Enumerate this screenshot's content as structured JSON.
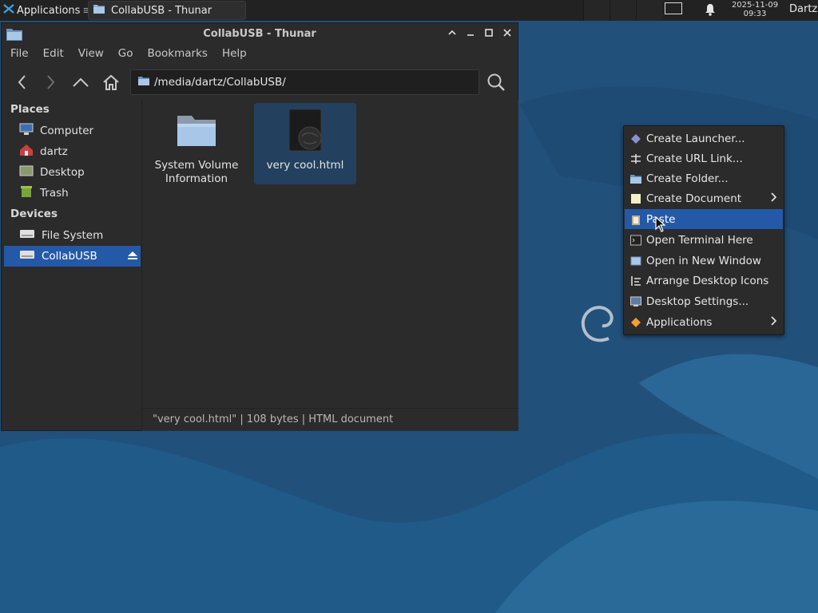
{
  "panel": {
    "applications_label": "Applications",
    "applications_suffix": "≡",
    "task_label": "CollabUSB - Thunar",
    "clock_date": "2025-11-09",
    "clock_time": "09:33",
    "user": "Dartz"
  },
  "window": {
    "title": "CollabUSB - Thunar",
    "menu": [
      "File",
      "Edit",
      "View",
      "Go",
      "Bookmarks",
      "Help"
    ],
    "path": "/media/dartz/CollabUSB/",
    "sidebar": {
      "places_header": "Places",
      "places": [
        {
          "label": "Computer",
          "icon": "computer-icon"
        },
        {
          "label": "dartz",
          "icon": "home-icon"
        },
        {
          "label": "Desktop",
          "icon": "desktop-icon"
        },
        {
          "label": "Trash",
          "icon": "trash-icon"
        }
      ],
      "devices_header": "Devices",
      "devices": [
        {
          "label": "File System",
          "icon": "drive-icon"
        },
        {
          "label": "CollabUSB",
          "icon": "usb-drive-icon",
          "selected": true
        }
      ]
    },
    "files": [
      {
        "name_line1": "System Volume",
        "name_line2": "Information",
        "icon": "folder-icon",
        "selected": false
      },
      {
        "name_line1": "very cool.html",
        "name_line2": "",
        "icon": "html-file-icon",
        "selected": true
      }
    ],
    "status": {
      "text": "\"very cool.html\"  |  108 bytes  |  HTML document"
    }
  },
  "context_menu": {
    "items": [
      {
        "label": "Create Launcher...",
        "icon": "launcher-icon",
        "submenu": false
      },
      {
        "label": "Create URL Link...",
        "icon": "link-icon",
        "submenu": false
      },
      {
        "label": "Create Folder...",
        "icon": "folder-icon",
        "submenu": false
      },
      {
        "label": "Create Document",
        "icon": "document-icon",
        "submenu": true
      },
      {
        "label": "Paste",
        "icon": "clipboard-icon",
        "submenu": false,
        "highlighted": true
      },
      {
        "label": "Open Terminal Here",
        "icon": "terminal-icon",
        "submenu": false
      },
      {
        "label": "Open in New Window",
        "icon": "window-icon",
        "submenu": false
      },
      {
        "label": "Arrange Desktop Icons",
        "icon": "arrange-icon",
        "submenu": false
      },
      {
        "label": "Desktop Settings...",
        "icon": "settings-icon",
        "submenu": false
      },
      {
        "label": "Applications",
        "icon": "applications-icon",
        "submenu": true
      }
    ]
  },
  "colors": {
    "accent": "#2459a7",
    "desktop": "#23527a",
    "window_bg": "#2b2b2b"
  }
}
